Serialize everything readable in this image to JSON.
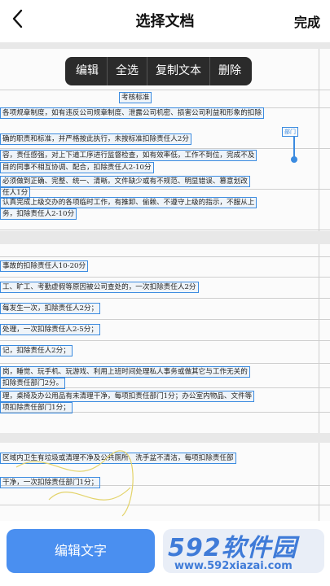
{
  "header": {
    "title": "选择文档",
    "done_label": "完成"
  },
  "context_menu": {
    "items": [
      "编辑",
      "全选",
      "复制文本",
      "删除"
    ]
  },
  "document": {
    "page1": {
      "heading": "考核标准",
      "tag": "部门",
      "lines": [
        "各项规章制度，如有违反公司规章制度、泄露公司机密、损害公司利益和形象的扣除",
        "确的职责和标准，并严格按此执行，未按标准扣除责任人2分",
        "容，责任感强，对上下道工序进行监督检查，如有效率低，工作不到位，完成不及",
        "目的同事不相互协调、配合，扣除责任人2-10分",
        "必须做到正确、完整、统一、清晰。文件缺少或有不规范、明显错误、篡意划改",
        "任人1分",
        "认真完成上级交办的各项临时工作，有推卸、偷赖、不遵守上级的指示，不服从上",
        "务，扣除责任人2-10分"
      ]
    },
    "page2": {
      "lines": [
        "事故的扣除责任人10-20分",
        "工、旷工、考勤虚假等原因被公司查处的，一次扣除责任人2分",
        "每发生一次，扣除责任人2分；",
        "处理，一次扣除责任人2-5分；",
        "记，扣除责任人2分；",
        "岗，睡觉、玩手机、玩游戏、利用上班时间处理私人事务或做其它与工作无关的",
        "扣除责任部门2分。",
        "理，桌椅及办公用品有未清理干净，每项扣责任部门1分；办公室内物品、文件等",
        "项扣除责任部门1分；"
      ]
    },
    "page3": {
      "lines": [
        "区域内卫生有垃圾或清理不净及公共厕所、洗手盆不清洁，每项扣除责任部",
        "干净，一次扣除责任部门1分；"
      ]
    }
  },
  "bottom": {
    "edit_label": "编辑文字"
  },
  "watermark": {
    "brand": "592软件园",
    "url": "www.592xiazai.com"
  },
  "colors": {
    "accent": "#4a8ff0",
    "selection": "#3b8be0"
  }
}
